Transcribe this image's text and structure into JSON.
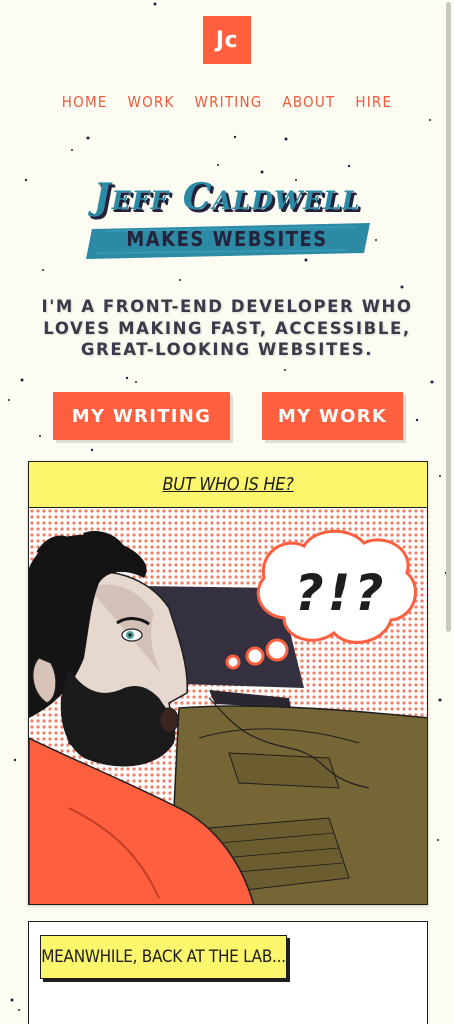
{
  "logo": {
    "text": "Jc"
  },
  "nav": {
    "items": [
      {
        "label": "HOME"
      },
      {
        "label": "WORK"
      },
      {
        "label": "WRITING"
      },
      {
        "label": "ABOUT"
      },
      {
        "label": "HIRE"
      }
    ]
  },
  "hero": {
    "name": "Jeff Caldwell",
    "subtitle": "MAKES WEBSITES",
    "tagline": "I'M A FRONT-END DEVELOPER WHO LOVES MAKING FAST, ACCESSIBLE, GREAT-LOOKING WEBSITES."
  },
  "buttons": {
    "writing": "MY WRITING",
    "work": "MY WORK"
  },
  "panels": {
    "first_caption": "BUT WHO IS HE?",
    "thought_text": "?!?",
    "second_caption": "MEANWHILE, BACK AT THE LAB..."
  },
  "colors": {
    "accent": "#fe5f3f",
    "teal": "#2d8aa5",
    "navy": "#24233b",
    "caption_yellow": "#fbf66b",
    "background": "#fdfcf3"
  }
}
